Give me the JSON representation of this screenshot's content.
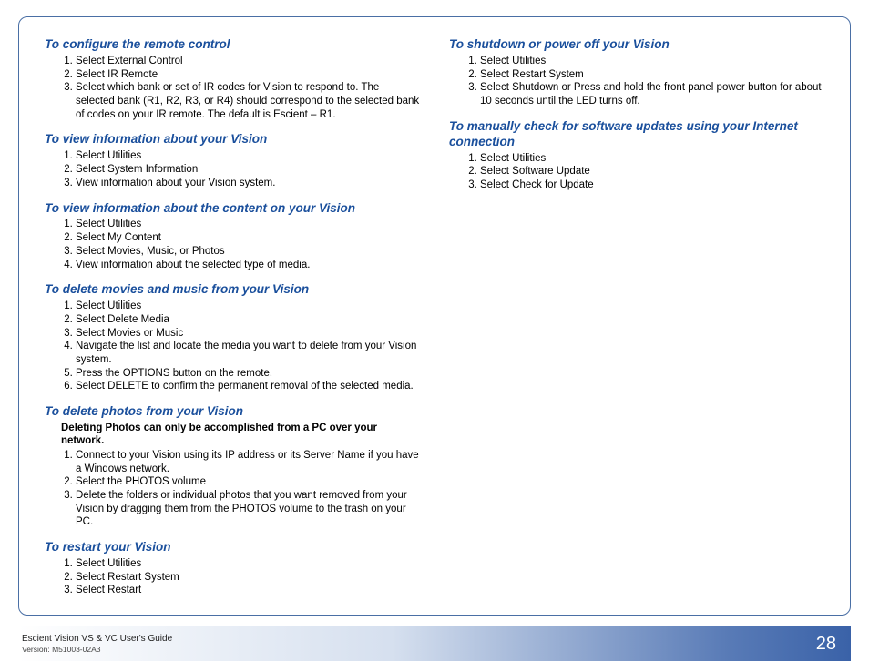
{
  "left": [
    {
      "heading": "To configure the remote control",
      "steps": [
        "Select External Control",
        "Select IR Remote",
        "Select which bank or set of IR codes for Vision to respond to. The selected bank (R1, R2, R3, or R4) should correspond to the selected bank of codes on your IR remote. The default is Escient – R1."
      ]
    },
    {
      "heading": "To view information about your Vision",
      "steps": [
        "Select Utilities",
        "Select System Information",
        "View information about your Vision system."
      ]
    },
    {
      "heading": "To view information about the content on your Vision",
      "steps": [
        "Select Utilities",
        "Select My Content",
        "Select Movies, Music, or Photos",
        "View information about the selected type of media."
      ]
    },
    {
      "heading": "To delete movies and music from your Vision",
      "steps": [
        "Select Utilities",
        "Select Delete Media",
        "Select Movies or Music",
        "Navigate the list and locate the media you want to delete from your Vision system.",
        "Press the OPTIONS button on the remote.",
        "Select DELETE to confirm the permanent removal of the selected media."
      ]
    },
    {
      "heading": "To delete photos from your Vision",
      "note": "Deleting Photos can only be accomplished from a PC over your network.",
      "steps": [
        "Connect to your Vision using its IP address or its Server Name if you have a Windows network.",
        "Select the PHOTOS volume",
        "Delete the folders or individual photos that you want removed from your Vision by dragging them from the PHOTOS volume to the trash on your PC."
      ]
    },
    {
      "heading": "To restart your Vision",
      "steps": [
        "Select Utilities",
        "Select Restart System",
        "Select Restart"
      ]
    }
  ],
  "right": [
    {
      "heading": "To shutdown or power off your Vision",
      "steps": [
        "Select Utilities",
        "Select Restart System",
        "Select Shutdown or Press and hold the front panel power button for about 10 seconds until the LED turns off."
      ]
    },
    {
      "heading": "To manually check for software updates using your Internet connection",
      "steps": [
        "Select Utilities",
        "Select Software Update",
        "Select Check for Update"
      ]
    }
  ],
  "footer": {
    "guide": "Escient Vision VS & VC User's Guide",
    "version": "Version: M51003-02A3",
    "page": "28"
  }
}
